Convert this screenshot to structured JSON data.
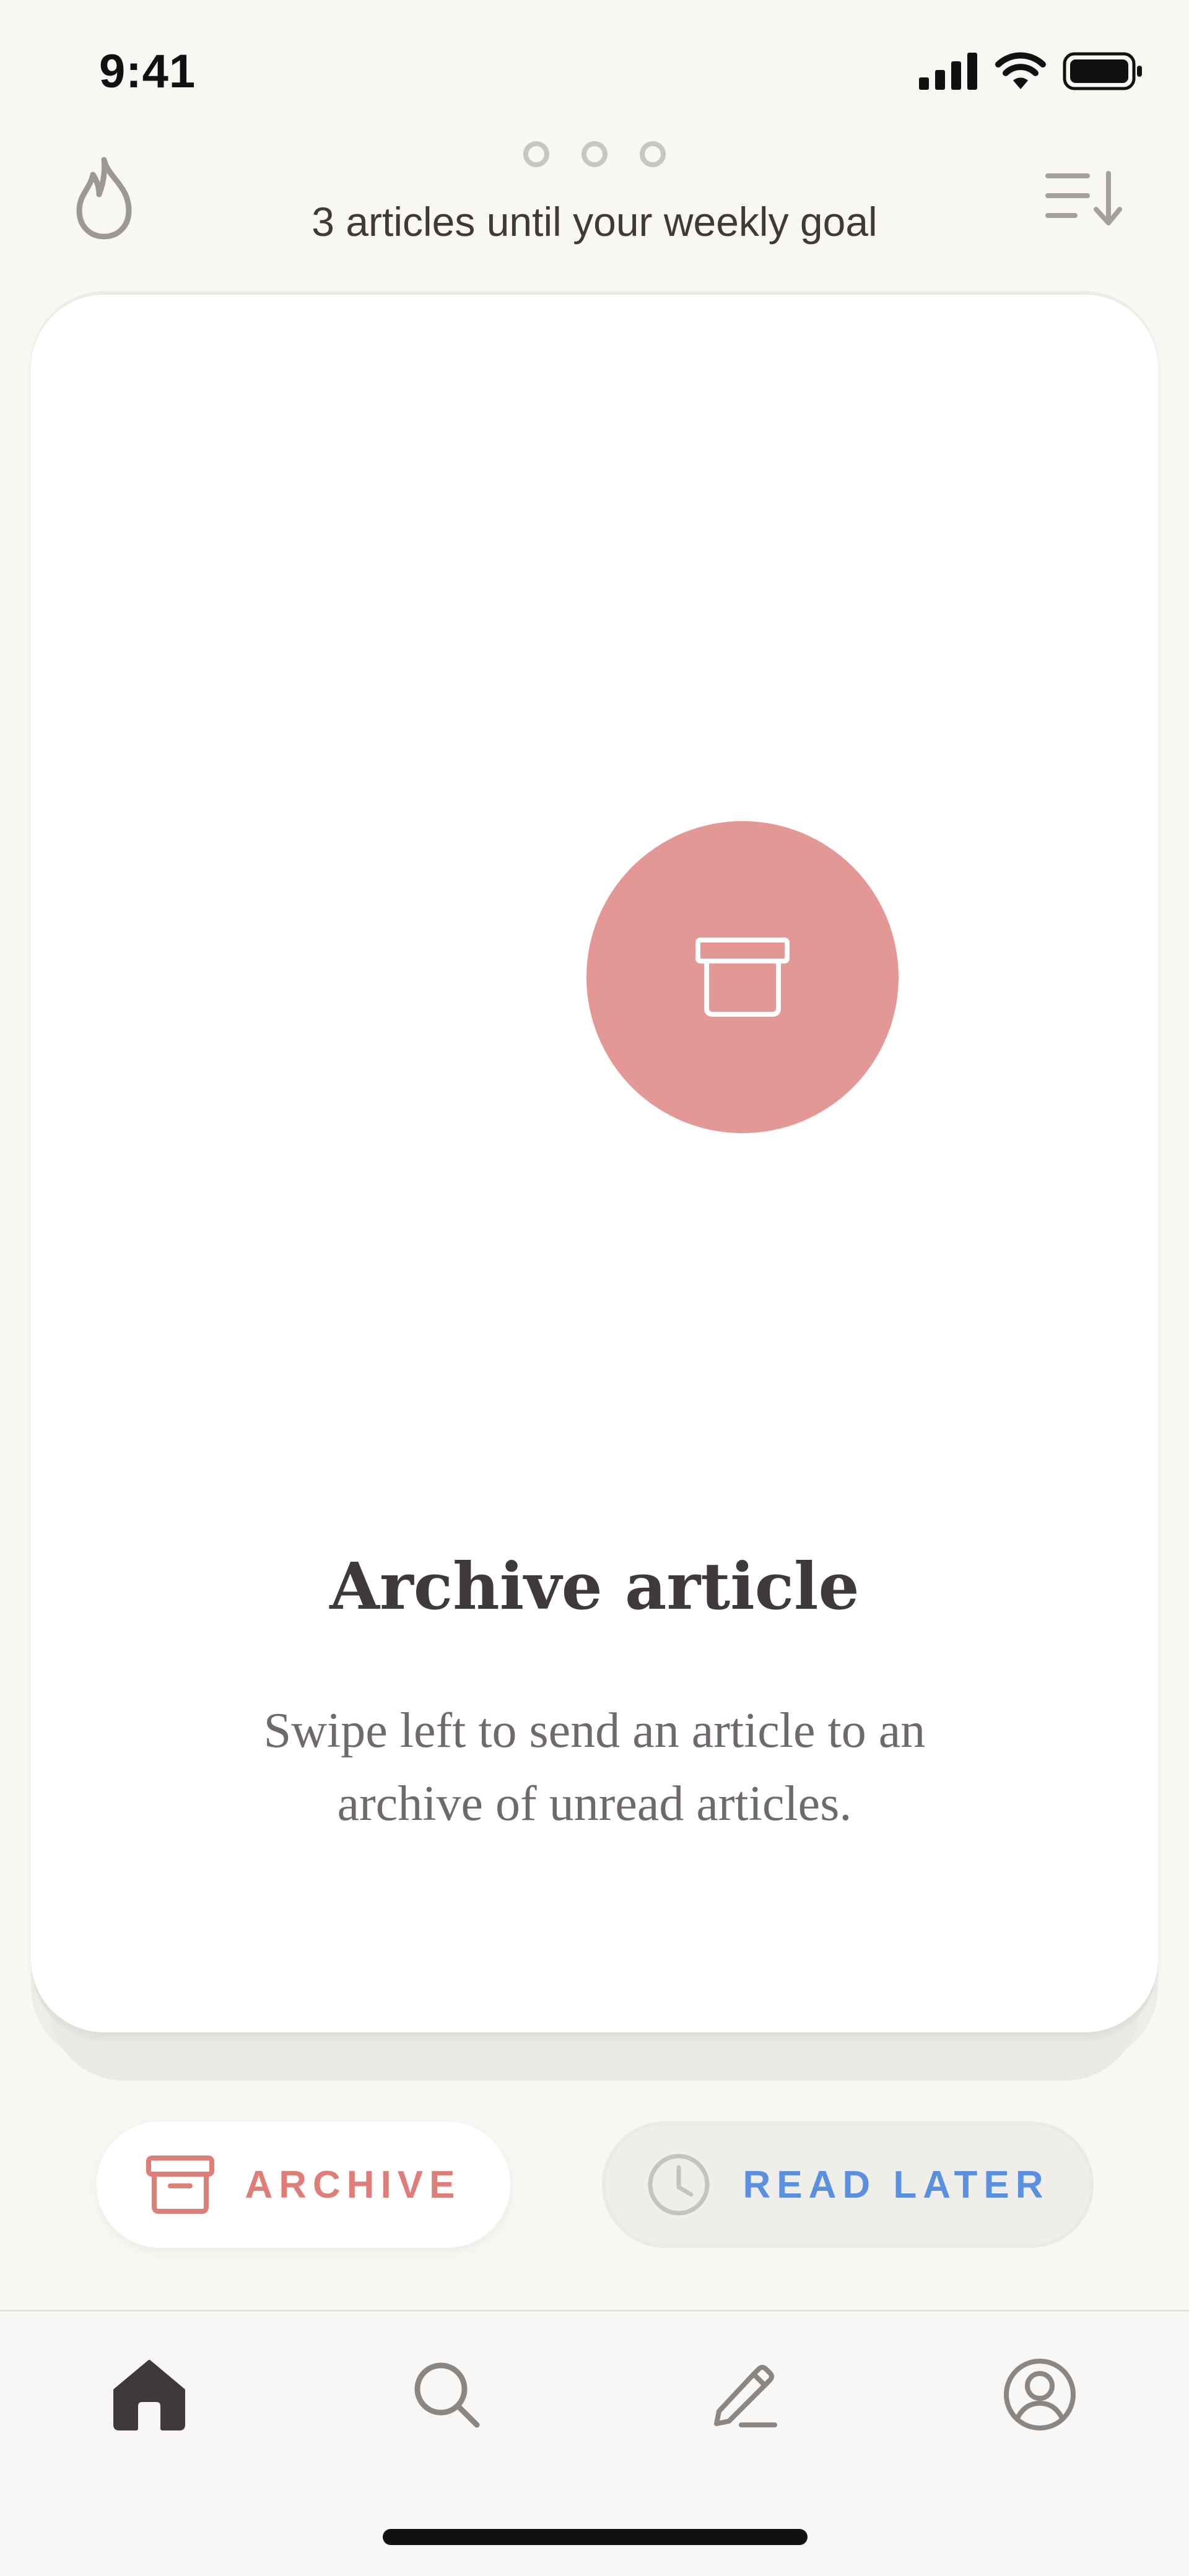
{
  "status_bar": {
    "time": "9:41",
    "icons": [
      "cellular-signal-icon",
      "wifi-icon",
      "battery-icon"
    ]
  },
  "header": {
    "streak_icon": "flame-icon",
    "goal_progress": {
      "completed": 0,
      "total": 3
    },
    "goal_text": "3 articles until your weekly goal",
    "sort_icon": "sort-descending-icon"
  },
  "card": {
    "icon": "archive-icon",
    "title": "Archive article",
    "description": "Swipe left to send an article to an archive of unread articles."
  },
  "actions": {
    "archive_label": "ARCHIVE",
    "archive_icon": "archive-icon",
    "read_later_label": "READ LATER",
    "read_later_icon": "clock-icon"
  },
  "tabbar": {
    "items": [
      {
        "name": "home",
        "icon": "home-icon",
        "active": true
      },
      {
        "name": "search",
        "icon": "search-icon",
        "active": false
      },
      {
        "name": "write",
        "icon": "pen-icon",
        "active": false
      },
      {
        "name": "profile",
        "icon": "profile-icon",
        "active": false
      }
    ]
  },
  "colors": {
    "background": "#f8f7f4",
    "archive_accent": "#e49895",
    "archive_text": "#df7d79",
    "read_later_text": "#5a90df",
    "text_primary": "#3f3a39"
  }
}
